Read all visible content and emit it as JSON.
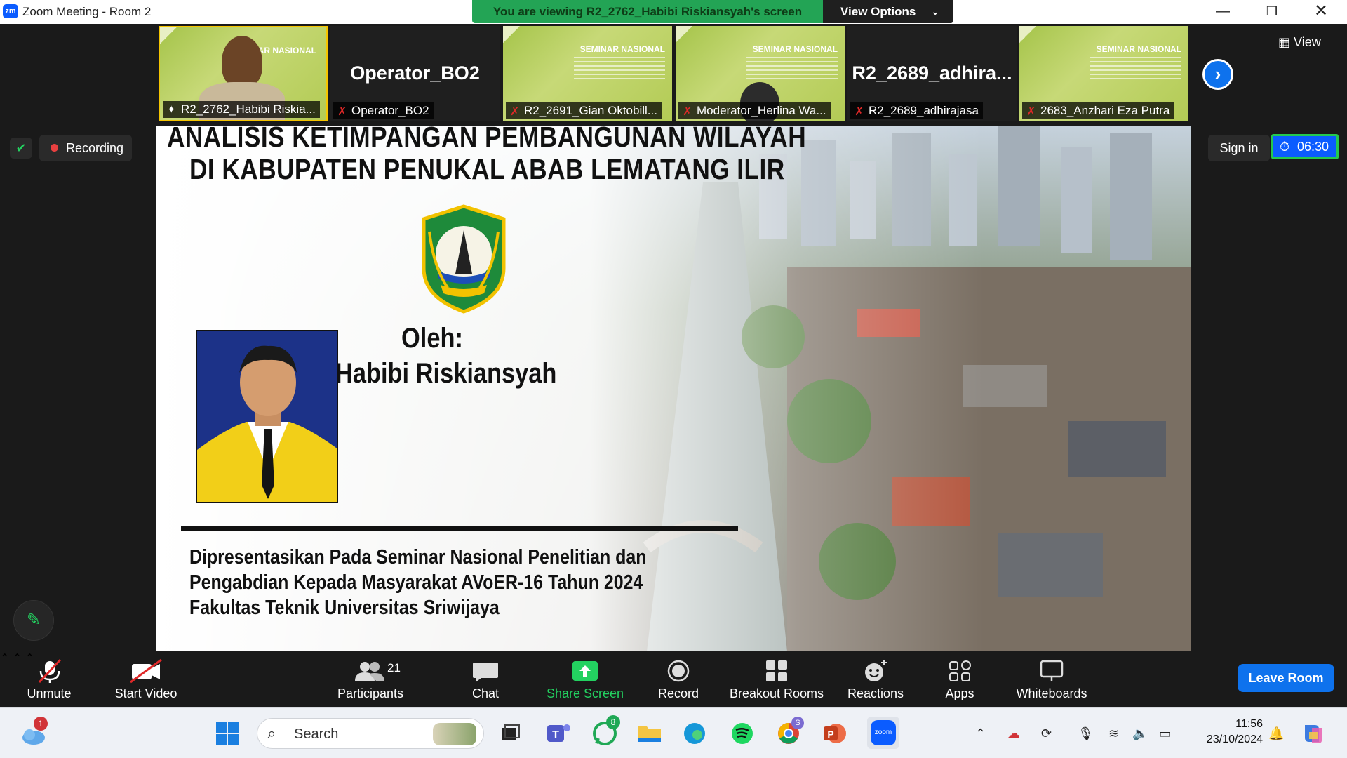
{
  "window": {
    "title": "Zoom Meeting - Room 2",
    "logo": "zm"
  },
  "banner": {
    "viewing": "You are viewing R2_2762_Habibi Riskiansyah's screen",
    "view_options": "View Options"
  },
  "thumb_text": {
    "seminar": "SEMINAR NASIONAL",
    "seminar_partial": "AR NASIONAL"
  },
  "participants": [
    {
      "label": "R2_2762_Habibi Riskia...",
      "video": true,
      "pinned": true,
      "muted": false
    },
    {
      "label": "Operator_BO2",
      "big": "Operator_BO2",
      "video": false,
      "muted": true
    },
    {
      "label": "R2_2691_Gian Oktobill...",
      "video": true,
      "muted": true
    },
    {
      "label": "Moderator_Herlina Wa...",
      "video": true,
      "muted": true
    },
    {
      "label": "R2_2689_adhirajasa",
      "big": "R2_2689_adhira...",
      "video": false,
      "muted": true
    },
    {
      "label": "2683_Anzhari Eza Putra",
      "video": true,
      "muted": true
    }
  ],
  "view_button": "View",
  "status": {
    "recording": "Recording",
    "sign_in": "Sign in",
    "timer": "06:30"
  },
  "slide": {
    "title_line1": "ANALISIS KETIMPANGAN PEMBANGUNAN WILAYAH",
    "title_line2": "DI KABUPATEN PENUKAL ABAB LEMATANG ILIR",
    "oleh": "Oleh:",
    "presenter": "Habibi Riskiansyah",
    "footer_line1": "Dipresentasikan Pada Seminar Nasional Penelitian dan",
    "footer_line2": "Pengabdian Kepada Masyarakat AVoER-16 Tahun 2024",
    "footer_line3": "Fakultas Teknik Universitas Sriwijaya"
  },
  "toolbar": {
    "unmute": "Unmute",
    "start_video": "Start Video",
    "participants": "Participants",
    "participants_count": "21",
    "chat": "Chat",
    "share_screen": "Share Screen",
    "record": "Record",
    "breakout_rooms": "Breakout Rooms",
    "reactions": "Reactions",
    "apps": "Apps",
    "whiteboards": "Whiteboards",
    "leave_room": "Leave Room"
  },
  "taskbar": {
    "search_placeholder": "Search",
    "weather_badge": "1",
    "whatsapp_badge": "8",
    "chrome_badge": "S",
    "zoom_label": "zoom",
    "time": "11:56",
    "date": "23/10/2024"
  },
  "colors": {
    "accent": "#0e72ed",
    "banner_green": "#23a455",
    "share_green": "#23d160",
    "muted_red": "#e02828"
  }
}
